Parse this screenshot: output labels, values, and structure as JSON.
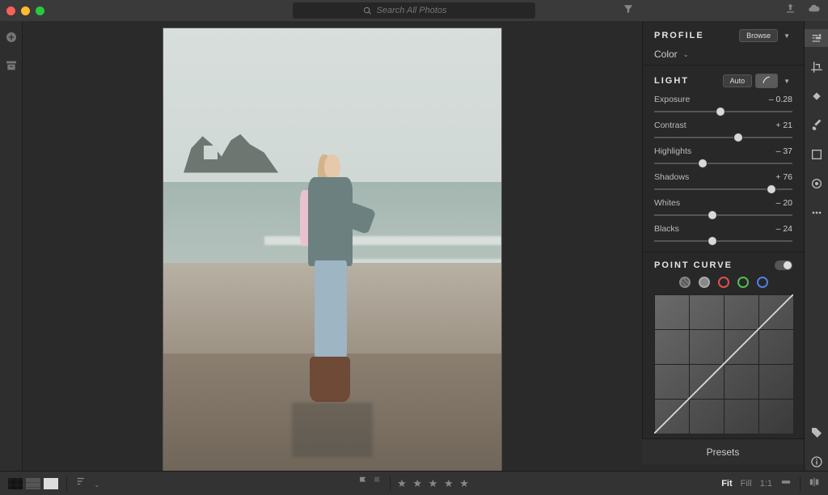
{
  "search": {
    "placeholder": "Search All Photos"
  },
  "profile": {
    "title": "PROFILE",
    "browse": "Browse",
    "mode": "Color"
  },
  "light": {
    "title": "LIGHT",
    "auto": "Auto",
    "sliders": [
      {
        "label": "Exposure",
        "value": "– 0.28",
        "pos": 48
      },
      {
        "label": "Contrast",
        "value": "+ 21",
        "pos": 61
      },
      {
        "label": "Highlights",
        "value": "– 37",
        "pos": 35
      },
      {
        "label": "Shadows",
        "value": "+ 76",
        "pos": 85
      },
      {
        "label": "Whites",
        "value": "– 20",
        "pos": 42
      },
      {
        "label": "Blacks",
        "value": "– 24",
        "pos": 42
      }
    ]
  },
  "point_curve": {
    "title": "POINT CURVE"
  },
  "presets": {
    "label": "Presets"
  },
  "zoom": {
    "fit": "Fit",
    "fill": "Fill",
    "one": "1:1"
  }
}
